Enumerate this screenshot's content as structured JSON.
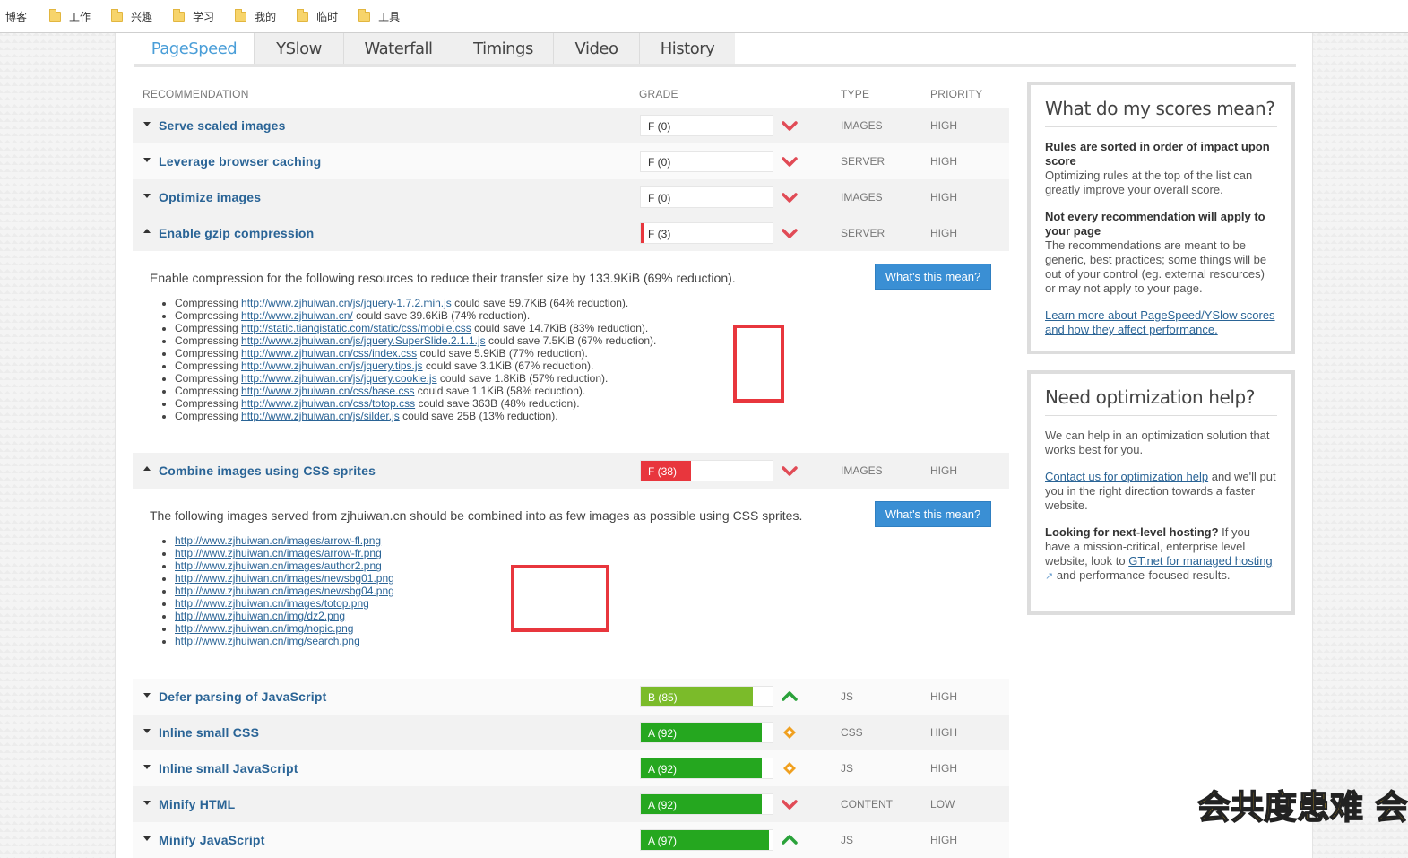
{
  "bookmarks": [
    "博客",
    "工作",
    "兴趣",
    "学习",
    "我的",
    "临时",
    "工具"
  ],
  "tabs": [
    "PageSpeed",
    "YSlow",
    "Waterfall",
    "Timings",
    "Video",
    "History"
  ],
  "columns": {
    "recommendation": "RECOMMENDATION",
    "grade": "GRADE",
    "type": "TYPE",
    "priority": "PRIORITY"
  },
  "rows": [
    {
      "name": "Serve scaled images",
      "grade": "F (0)",
      "type": "IMAGES",
      "priority": "HIGH",
      "trend": "down",
      "score": 0,
      "color": "#e8363d",
      "expanded": false
    },
    {
      "name": "Leverage browser caching",
      "grade": "F (0)",
      "type": "SERVER",
      "priority": "HIGH",
      "trend": "down",
      "score": 0,
      "color": "#e8363d",
      "expanded": false
    },
    {
      "name": "Optimize images",
      "grade": "F (0)",
      "type": "IMAGES",
      "priority": "HIGH",
      "trend": "down",
      "score": 0,
      "color": "#e8363d",
      "expanded": false
    },
    {
      "name": "Enable gzip compression",
      "grade": "F (3)",
      "type": "SERVER",
      "priority": "HIGH",
      "trend": "down",
      "score": 3,
      "color": "#e8363d",
      "expanded": true
    },
    {
      "name": "Combine images using CSS sprites",
      "grade": "F (38)",
      "type": "IMAGES",
      "priority": "HIGH",
      "trend": "down",
      "score": 38,
      "color": "#e8363d",
      "expanded": true
    },
    {
      "name": "Defer parsing of JavaScript",
      "grade": "B (85)",
      "type": "JS",
      "priority": "HIGH",
      "trend": "up",
      "score": 85,
      "color": "#7bbb2a",
      "expanded": false
    },
    {
      "name": "Inline small CSS",
      "grade": "A (92)",
      "type": "CSS",
      "priority": "HIGH",
      "trend": "diamond",
      "score": 92,
      "color": "#25a71f",
      "expanded": false
    },
    {
      "name": "Inline small JavaScript",
      "grade": "A (92)",
      "type": "JS",
      "priority": "HIGH",
      "trend": "diamond",
      "score": 92,
      "color": "#25a71f",
      "expanded": false
    },
    {
      "name": "Minify HTML",
      "grade": "A (92)",
      "type": "CONTENT",
      "priority": "LOW",
      "trend": "down",
      "score": 92,
      "color": "#25a71f",
      "expanded": false
    },
    {
      "name": "Minify JavaScript",
      "grade": "A (97)",
      "type": "JS",
      "priority": "HIGH",
      "trend": "up",
      "score": 97,
      "color": "#25a71f",
      "expanded": false
    }
  ],
  "gzip_detail": {
    "summary": "Enable compression for the following resources to reduce their transfer size by 133.9KiB (69% reduction).",
    "button": "What's this mean?",
    "items": [
      {
        "prefix": "Compressing ",
        "url": "http://www.zjhuiwan.cn/js/jquery-1.7.2.min.js",
        "suffix": " could save 59.7KiB (64% reduction)."
      },
      {
        "prefix": "Compressing ",
        "url": "http://www.zjhuiwan.cn/",
        "suffix": " could save 39.6KiB (74% reduction)."
      },
      {
        "prefix": "Compressing ",
        "url": "http://static.tianqistatic.com/static/css/mobile.css",
        "suffix": " could save 14.7KiB (83% reduction)."
      },
      {
        "prefix": "Compressing ",
        "url": "http://www.zjhuiwan.cn/js/jquery.SuperSlide.2.1.1.js",
        "suffix": " could save 7.5KiB (67% reduction)."
      },
      {
        "prefix": "Compressing ",
        "url": "http://www.zjhuiwan.cn/css/index.css",
        "suffix": " could save 5.9KiB (77% reduction)."
      },
      {
        "prefix": "Compressing ",
        "url": "http://www.zjhuiwan.cn/js/jquery.tips.js",
        "suffix": " could save 3.1KiB (67% reduction)."
      },
      {
        "prefix": "Compressing ",
        "url": "http://www.zjhuiwan.cn/js/jquery.cookie.js",
        "suffix": " could save 1.8KiB (57% reduction)."
      },
      {
        "prefix": "Compressing ",
        "url": "http://www.zjhuiwan.cn/css/base.css",
        "suffix": " could save 1.1KiB (58% reduction)."
      },
      {
        "prefix": "Compressing ",
        "url": "http://www.zjhuiwan.cn/css/totop.css",
        "suffix": " could save 363B (48% reduction)."
      },
      {
        "prefix": "Compressing ",
        "url": "http://www.zjhuiwan.cn/js/silder.js",
        "suffix": " could save 25B (13% reduction)."
      }
    ]
  },
  "sprites_detail": {
    "summary": "The following images served from zjhuiwan.cn should be combined into as few images as possible using CSS sprites.",
    "button": "What's this mean?",
    "items": [
      "http://www.zjhuiwan.cn/images/arrow-fl.png",
      "http://www.zjhuiwan.cn/images/arrow-fr.png",
      "http://www.zjhuiwan.cn/images/author2.png",
      "http://www.zjhuiwan.cn/images/newsbg01.png",
      "http://www.zjhuiwan.cn/images/newsbg04.png",
      "http://www.zjhuiwan.cn/images/totop.png",
      "http://www.zjhuiwan.cn/img/dz2.png",
      "http://www.zjhuiwan.cn/img/nopic.png",
      "http://www.zjhuiwan.cn/img/search.png"
    ]
  },
  "scores_box": {
    "title": "What do my scores mean?",
    "h1": "Rules are sorted in order of impact upon score",
    "p1": "Optimizing rules at the top of the list can greatly improve your overall score.",
    "h2": "Not every recommendation will apply to your page",
    "p2": "The recommendations are meant to be generic, best practices; some things will be out of your control (eg. external resources) or may not apply to your page.",
    "link": "Learn more about PageSpeed/YSlow scores and how they affect performance."
  },
  "help_box": {
    "title": "Need optimization help?",
    "p1": "We can help in an optimization solution that works best for you.",
    "link1": "Contact us for optimization help",
    "p2": " and we'll put you in the right direction towards a faster website.",
    "h3": "Looking for next-level hosting?",
    "p3": " If you have a mission-critical, enterprise level website, look to ",
    "link2": "GT.net for managed hosting",
    "p4": " and performance-focused results."
  },
  "watermark": "会共度患难 会"
}
